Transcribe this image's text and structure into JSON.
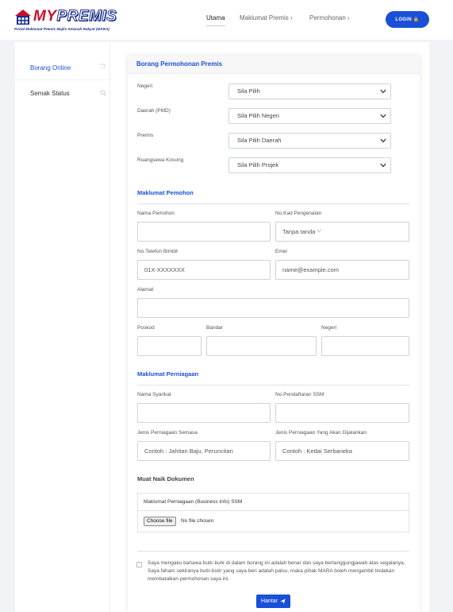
{
  "header": {
    "logo_my": "MY",
    "logo_premis": "PREMIS",
    "logo_subtitle": "Portal Maklumat Premis Majlis Amanah Rakyat (MARA)",
    "nav": [
      {
        "label": "Utama"
      },
      {
        "label": "Maklumat Premis ›"
      },
      {
        "label": "Permohonan ›"
      }
    ],
    "login_label": "LOGIN 🔒"
  },
  "sidebar": {
    "items": [
      {
        "label": "Borang Online"
      },
      {
        "label": "Semak Status"
      }
    ]
  },
  "form": {
    "title": "Borang Permohonan Premis",
    "fields": {
      "negeri": {
        "label": "Negeri",
        "value": "Sila Pilih"
      },
      "daerah": {
        "label": "Daerah (PMD)",
        "value": "Sila Pilih Negeri"
      },
      "premis": {
        "label": "Premis",
        "value": "Sila Pilih Daerah"
      },
      "ruang": {
        "label": "Ruangsewa Kosong",
        "value": "Sila Pilih Projek"
      }
    },
    "pemohon": {
      "title": "Maklumat Pemohon",
      "nama_label": "Nama Pemohon",
      "kad_label": "No.Kad Pengenalan",
      "kad_placeholder": "Tanpa tanda '-'",
      "telefon_label": "No.Telefon Bimbit",
      "telefon_placeholder": "01X-XXXXXXX",
      "emel_label": "Emel",
      "emel_placeholder": "name@example.com",
      "alamat_label": "Alamat",
      "poskod_label": "Poskod",
      "bandar_label": "Bandar",
      "negeri_label": "Negeri"
    },
    "perniagaan": {
      "title": "Maklumat Perniagaan",
      "syarikat_label": "Nama Syarikat",
      "ssm_label": "No.Pendaftaran SSM",
      "semasa_label": "Jenis Perniagaan Semasa",
      "semasa_placeholder": "Contoh : Jahitan Baju, Peruncitan",
      "akan_label": "Jenis Perniagaan Yang Akan Dijalankan",
      "akan_placeholder": "Contoh : Kedai Serbaneka"
    },
    "dokumen": {
      "title": "Muat Naik Dokumen",
      "box_title": "Maklumat Perniagaan (Business Info) SSM",
      "choose_label": "Choose file",
      "no_file": "No file chosen"
    },
    "consent": "Saya mengaku bahawa butir-butir di dalam borang ini adalah benar dan saya bertanggungjawab atas segalanya. Saya faham sekiranya butir-butir yang saya beri adalah palsu, maka pihak MARA boleh mengambil tindakan membatalkan permohonan saya ini.",
    "submit_label": "Hantar"
  },
  "colors": {
    "accent": "#1a4fd8",
    "brand_red": "#c8102e"
  }
}
